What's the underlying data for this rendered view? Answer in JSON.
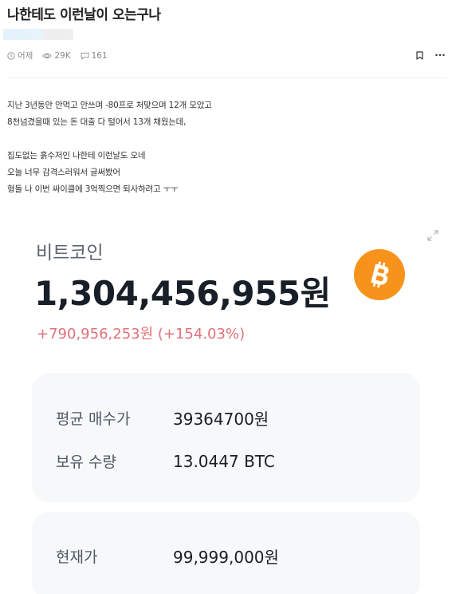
{
  "post": {
    "title": "나한테도 이런날이 오는구나",
    "meta": {
      "time": "어제",
      "views": "29K",
      "comments": "161"
    },
    "body_lines": [
      "지난 3년동안 안먹고 안쓰며 -80프로 처맞으며 12개 모았고",
      "8천넘겼을때 있는 돈 대출 다 털어서 13개 채웠는데,",
      "",
      "집도없는 흙수저인 나한테 이런날도 오네",
      "오늘 너무 감격스러워서 글써봤어",
      "형들 나 이번 싸이클에 3억찍으면 퇴사하려고 ㅜㅜ"
    ]
  },
  "asset": {
    "name": "비트코인",
    "value": "1,304,456,955원",
    "change": "+790,956,253원 (+154.03%)",
    "logo_icon": "bitcoin-icon",
    "holding": {
      "avg_price_label": "평균 매수가",
      "avg_price_value": "39364700원",
      "qty_label": "보유 수량",
      "qty_value": "13.0447 BTC"
    },
    "price": {
      "label": "현재가",
      "value": "99,999,000원"
    }
  },
  "colors": {
    "accent_bitcoin": "#f7931a",
    "profit_red": "#e0717a",
    "card_bg": "#f7f8f9"
  }
}
